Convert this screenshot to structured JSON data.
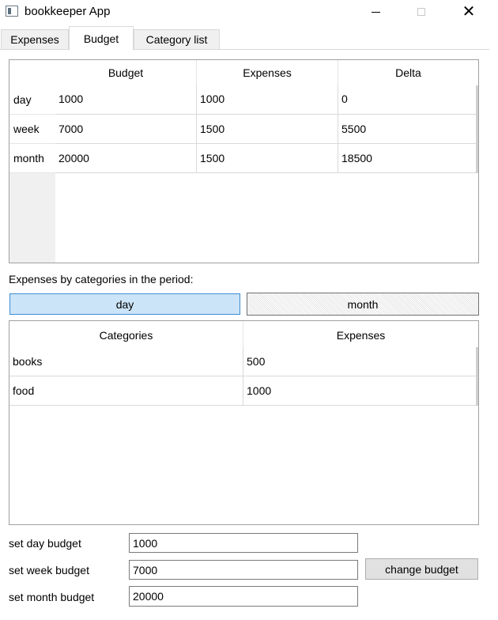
{
  "window": {
    "title": "bookkeeper App",
    "controls": {
      "minimize": "minimize",
      "maximize": "maximize",
      "close": "✕"
    }
  },
  "tabs": [
    {
      "label": "Expenses",
      "active": false
    },
    {
      "label": "Budget",
      "active": true
    },
    {
      "label": "Category list",
      "active": false
    }
  ],
  "budget_table": {
    "columns": [
      "Budget",
      "Expenses",
      "Delta"
    ],
    "rows": [
      {
        "label": "day",
        "cells": [
          "1000",
          "1000",
          "0"
        ]
      },
      {
        "label": "week",
        "cells": [
          "7000",
          "1500",
          "5500"
        ]
      },
      {
        "label": "month",
        "cells": [
          "20000",
          "1500",
          "18500"
        ]
      }
    ]
  },
  "period": {
    "caption": "Expenses by categories in the period:",
    "day_label": "day",
    "month_label": "month"
  },
  "category_table": {
    "columns": [
      "Categories",
      "Expenses"
    ],
    "rows": [
      {
        "cells": [
          "books",
          "500"
        ]
      },
      {
        "cells": [
          "food",
          "1000"
        ]
      }
    ]
  },
  "budget_form": {
    "day_label": "set day budget",
    "day_value": "1000",
    "week_label": "set week budget",
    "week_value": "7000",
    "month_label": "set month budget",
    "month_value": "20000",
    "change_button": "change budget"
  },
  "colors": {
    "active_button": "#cce4f7",
    "active_button_border": "#3c8ed6",
    "border": "#a0a0a0"
  }
}
